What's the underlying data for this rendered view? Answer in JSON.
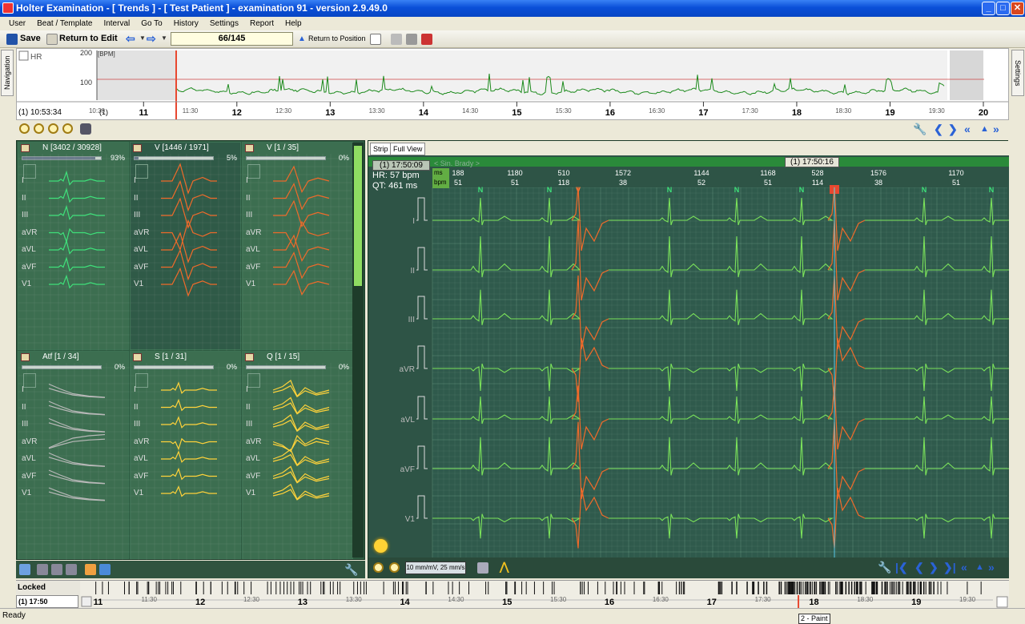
{
  "window": {
    "title": "Holter Examination - [ Trends ] - [ Test Patient ] - examination 91 - version 2.9.49.0"
  },
  "menu": [
    "User",
    "Beat / Template",
    "Interval",
    "Go To",
    "History",
    "Settings",
    "Report",
    "Help"
  ],
  "toolbar": {
    "save": "Save",
    "return_edit": "Return to Edit",
    "position": "66/145",
    "return_position": "Return to Position"
  },
  "side_tabs": {
    "left": "Navigation",
    "right": "Settings"
  },
  "hr_trend": {
    "checkbox_label": "HR",
    "unit": "[BPM]",
    "y_ticks": [
      "200",
      "100"
    ],
    "current_time": "(1) 10:53:34",
    "start_marker": "(1)",
    "hour_ticks": [
      "11",
      "12",
      "13",
      "14",
      "15",
      "16",
      "17",
      "18",
      "19",
      "20"
    ],
    "half_ticks": [
      "10:30",
      "11:30",
      "12:30",
      "13:30",
      "14:30",
      "15:30",
      "16:30",
      "17:30",
      "18:30",
      "19:30"
    ]
  },
  "templates": [
    {
      "label": "N  [3402 / 30928]",
      "pct": "93%",
      "color": "#3fe07a",
      "fill": 0.93
    },
    {
      "label": "V  [1446 / 1971]",
      "pct": "5%",
      "color": "#f06a2a",
      "fill": 0.05
    },
    {
      "label": "V  [1 / 35]",
      "pct": "0%",
      "color": "#f06a2a",
      "fill": 0.0
    },
    {
      "label": "Atf  [1 / 34]",
      "pct": "0%",
      "color": "#b8b8b8",
      "fill": 0.0
    },
    {
      "label": "S  [1 / 31]",
      "pct": "0%",
      "color": "#ffd23a",
      "fill": 0.0
    },
    {
      "label": "Q  [1 / 15]",
      "pct": "0%",
      "color": "#ffd23a",
      "fill": 0.0
    }
  ],
  "leads": [
    "I",
    "II",
    "III",
    "aVR",
    "aVL",
    "aVF",
    "V1"
  ],
  "ecg": {
    "tabs": [
      "Strip",
      "Full View"
    ],
    "time_start": "(1) 17:50:09",
    "time_cursor": "(1) 17:50:16",
    "rhythm": "< Sin. Brady >",
    "hr": "HR: 57 bpm",
    "qt": "QT: 461 ms",
    "ms_label": "ms",
    "bpm_label": "bpm",
    "ms_values": [
      "188",
      "1180",
      "510",
      "1572",
      "1144",
      "1168",
      "528",
      "1576",
      "1170"
    ],
    "bpm_values": [
      "51",
      "51",
      "118",
      "38",
      "52",
      "51",
      "114",
      "38",
      "51"
    ],
    "beat_labels": [
      "N",
      "N",
      "V",
      "N",
      "N",
      "N",
      "V",
      "N",
      "N"
    ],
    "speed": "10 mm/mV, 25 mm/s"
  },
  "timeline": {
    "locked": "Locked",
    "time": "(1) 17:50",
    "hour_ticks": [
      "11",
      "12",
      "13",
      "14",
      "15",
      "16",
      "17",
      "18",
      "19"
    ],
    "half_ticks": [
      "11:30",
      "12:30",
      "13:30",
      "14:30",
      "15:30",
      "16:30",
      "17:30",
      "18:30",
      "19:30"
    ]
  },
  "status": {
    "text": "Ready",
    "tooltip": "2 - Paint"
  }
}
